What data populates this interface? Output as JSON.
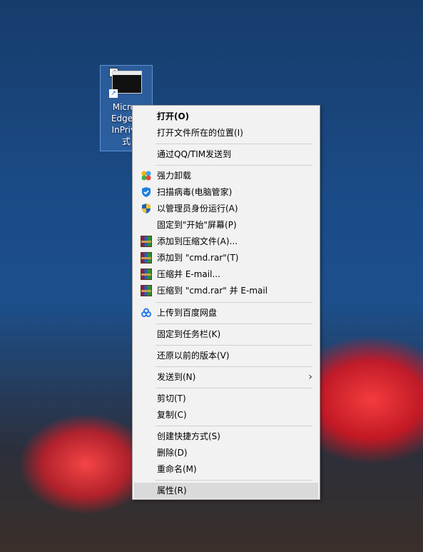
{
  "desktop_icon": {
    "label": "Microsoft Edge浏览器 InPrivate 模式",
    "label_visible_lines": [
      "Micros",
      "Edge浏",
      "InPriva",
      "式"
    ]
  },
  "context_menu": {
    "items": [
      {
        "label": "打开(O)",
        "bold": true
      },
      {
        "label": "打开文件所在的位置(I)"
      },
      {
        "label": "通过QQ/TIM发送到"
      },
      {
        "label": "强力卸载",
        "icon": "uninstall-icon"
      },
      {
        "label": "扫描病毒(电脑管家)",
        "icon": "shield-icon"
      },
      {
        "label": "以管理员身份运行(A)",
        "icon": "uac-shield-icon"
      },
      {
        "label": "固定到\"开始\"屏幕(P)"
      },
      {
        "label": "添加到压缩文件(A)...",
        "icon": "winrar-icon"
      },
      {
        "label": "添加到 \"cmd.rar\"(T)",
        "icon": "winrar-icon"
      },
      {
        "label": "压缩并 E-mail...",
        "icon": "winrar-icon"
      },
      {
        "label": "压缩到 \"cmd.rar\" 并 E-mail",
        "icon": "winrar-icon"
      },
      {
        "label": "上传到百度网盘",
        "icon": "baidu-netdisk-icon"
      },
      {
        "label": "固定到任务栏(K)"
      },
      {
        "label": "还原以前的版本(V)"
      },
      {
        "label": "发送到(N)",
        "submenu": true
      },
      {
        "label": "剪切(T)"
      },
      {
        "label": "复制(C)"
      },
      {
        "label": "创建快捷方式(S)"
      },
      {
        "label": "删除(D)"
      },
      {
        "label": "重命名(M)"
      },
      {
        "label": "属性(R)",
        "highlighted": true
      }
    ]
  },
  "colors": {
    "menu_bg": "#f2f2f2",
    "menu_hover": "#dadada",
    "selection": "#508cdc"
  }
}
